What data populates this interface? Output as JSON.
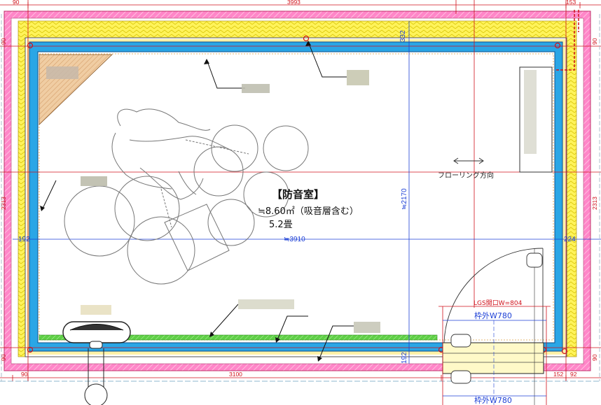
{
  "room": {
    "title": "【防音室】",
    "area": "≒8.60㎡（吸音層含む）",
    "tatami": "5.2畳",
    "flooring_note": "フローリング方向"
  },
  "dimensions": {
    "top_left": "90",
    "top_total": "3993",
    "top_right": "153",
    "left_total": "2313",
    "right_total": "2313",
    "side_90_left_top": "90",
    "side_90_left_bottom": "90",
    "side_90_right_top": "90",
    "side_90_right_bottom": "90",
    "top_inner": "332",
    "inner_height": "≒2170",
    "left_inner": "192",
    "inner_width": "≒3910",
    "right_inner": "224",
    "bottom_inner": "192",
    "bottom_left": "90",
    "bottom_mid": "3100",
    "bottom_r1": "152",
    "bottom_r2": "92"
  },
  "door": {
    "opening": "LGS開口W=804",
    "frame_top": "枠外W780",
    "frame_bottom": "枠外W780"
  },
  "colors": {
    "pink_wall": "#ff86c8",
    "yellow_layer": "#fff35a",
    "blue_wall": "#2aa6e6",
    "green_strip": "#5fd046",
    "dim_red": "#d0121b",
    "dim_blue": "#1c3fd6"
  }
}
